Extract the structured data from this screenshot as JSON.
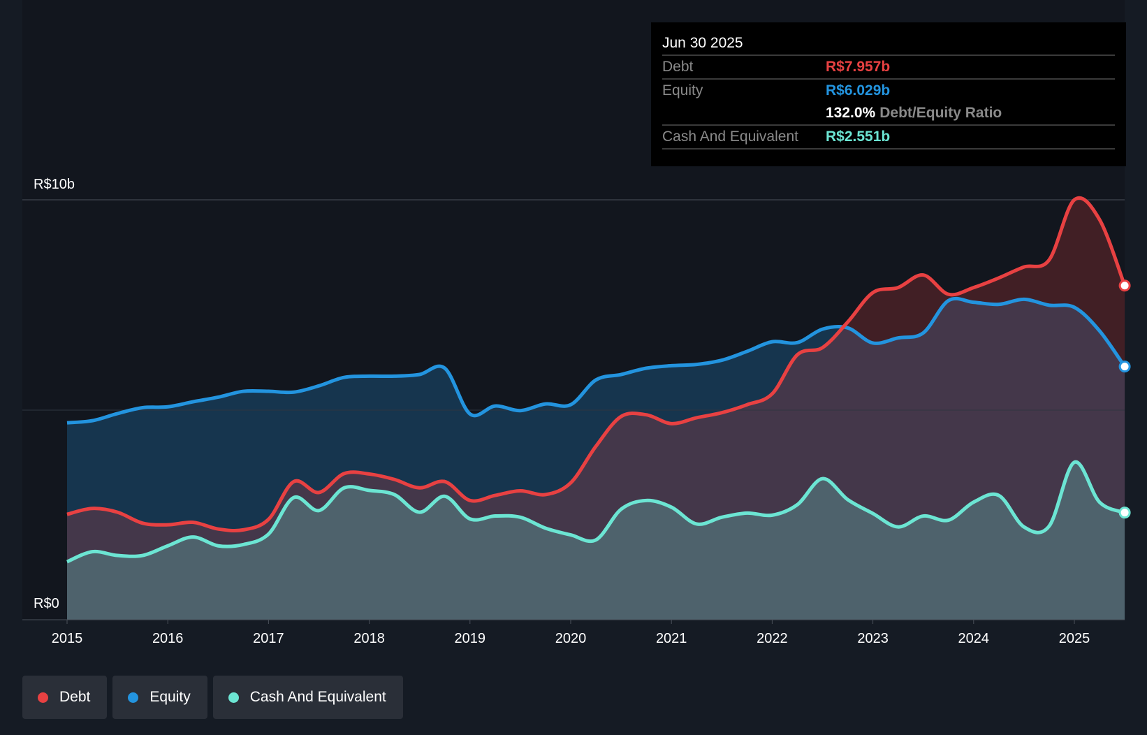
{
  "tooltip": {
    "date": "Jun 30 2025",
    "debt_label": "Debt",
    "debt_value": "R$7.957b",
    "equity_label": "Equity",
    "equity_value": "R$6.029b",
    "ratio_value": "132.0%",
    "ratio_label": "Debt/Equity Ratio",
    "cash_label": "Cash And Equivalent",
    "cash_value": "R$2.551b"
  },
  "legend": [
    {
      "label": "Debt",
      "color": "#e84142"
    },
    {
      "label": "Equity",
      "color": "#2394df"
    },
    {
      "label": "Cash And Equivalent",
      "color": "#6ce5d3"
    }
  ],
  "chart_data": {
    "type": "area",
    "title": "",
    "xlabel": "",
    "ylabel": "",
    "ylim": [
      0,
      10
    ],
    "y_unit": "R$ billions",
    "y_tick_labels": [
      "R$0",
      "R$10b"
    ],
    "x_tick_labels": [
      "2015",
      "2016",
      "2017",
      "2018",
      "2019",
      "2020",
      "2021",
      "2022",
      "2023",
      "2024",
      "2025"
    ],
    "x": [
      2015.0,
      2015.25,
      2015.5,
      2015.75,
      2016.0,
      2016.25,
      2016.5,
      2016.75,
      2017.0,
      2017.25,
      2017.5,
      2017.75,
      2018.0,
      2018.25,
      2018.5,
      2018.75,
      2019.0,
      2019.25,
      2019.5,
      2019.75,
      2020.0,
      2020.25,
      2020.5,
      2020.75,
      2021.0,
      2021.25,
      2021.5,
      2021.75,
      2022.0,
      2022.25,
      2022.5,
      2022.75,
      2023.0,
      2023.25,
      2023.5,
      2023.75,
      2024.0,
      2024.25,
      2024.5,
      2024.75,
      2025.0,
      2025.25,
      2025.5
    ],
    "series": [
      {
        "name": "Debt",
        "color": "#e84142",
        "values": [
          2.51,
          2.65,
          2.56,
          2.3,
          2.26,
          2.32,
          2.16,
          2.14,
          2.39,
          3.29,
          3.03,
          3.48,
          3.47,
          3.34,
          3.14,
          3.29,
          2.84,
          2.96,
          3.07,
          2.98,
          3.26,
          4.13,
          4.84,
          4.88,
          4.67,
          4.81,
          4.93,
          5.12,
          5.38,
          6.31,
          6.48,
          7.09,
          7.79,
          7.91,
          8.21,
          7.75,
          7.91,
          8.14,
          8.4,
          8.57,
          10.0,
          9.53,
          7.957
        ]
      },
      {
        "name": "Equity",
        "color": "#2394df",
        "values": [
          4.69,
          4.74,
          4.91,
          5.05,
          5.07,
          5.19,
          5.3,
          5.44,
          5.44,
          5.42,
          5.57,
          5.77,
          5.8,
          5.8,
          5.84,
          5.99,
          4.9,
          5.09,
          4.98,
          5.14,
          5.12,
          5.71,
          5.84,
          5.99,
          6.05,
          6.08,
          6.18,
          6.39,
          6.62,
          6.6,
          6.92,
          6.95,
          6.59,
          6.71,
          6.83,
          7.6,
          7.56,
          7.51,
          7.63,
          7.49,
          7.44,
          6.88,
          6.029
        ]
      },
      {
        "name": "Cash And Equivalent",
        "color": "#6ce5d3",
        "values": [
          1.38,
          1.62,
          1.53,
          1.53,
          1.76,
          1.97,
          1.76,
          1.79,
          2.04,
          2.91,
          2.6,
          3.14,
          3.08,
          2.98,
          2.56,
          2.94,
          2.4,
          2.47,
          2.44,
          2.18,
          2.02,
          1.9,
          2.63,
          2.84,
          2.68,
          2.28,
          2.44,
          2.54,
          2.49,
          2.74,
          3.36,
          2.86,
          2.53,
          2.21,
          2.47,
          2.37,
          2.8,
          2.96,
          2.21,
          2.23,
          3.75,
          2.8,
          2.551
        ]
      }
    ],
    "grid": true,
    "legend_position": "bottom-left"
  }
}
